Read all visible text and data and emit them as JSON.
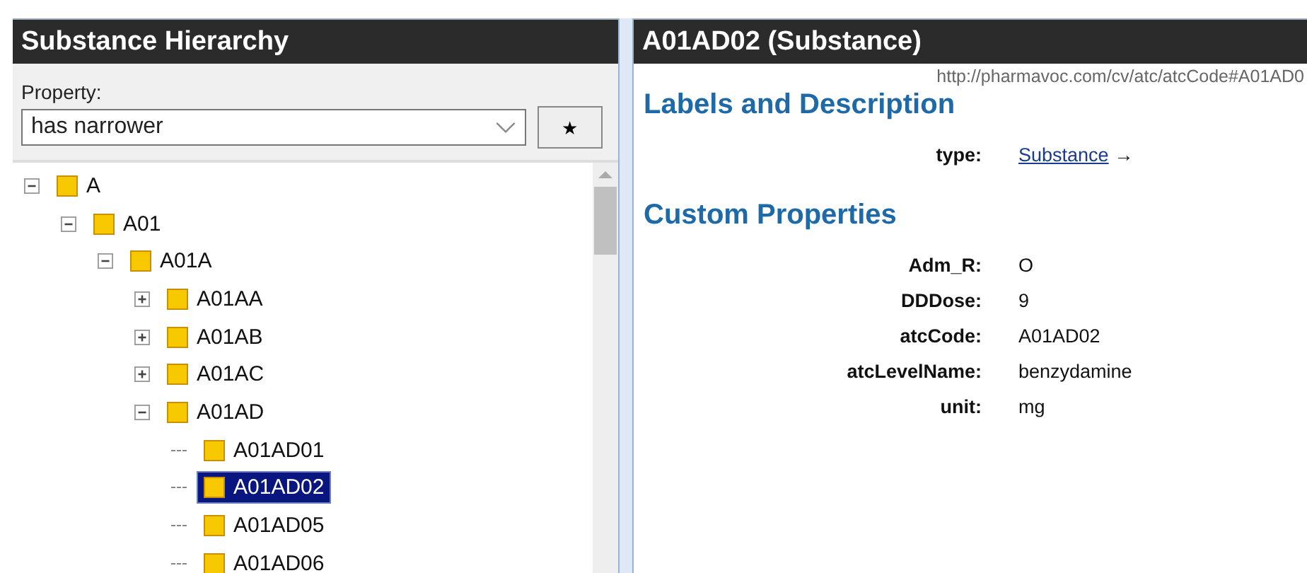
{
  "left_panel": {
    "title": "Substance Hierarchy",
    "property_label": "Property:",
    "property_select": {
      "value": "has narrower"
    },
    "star_button": {
      "label": "★"
    },
    "tree": [
      {
        "label": "A",
        "expanded": true,
        "selected": false,
        "children": [
          {
            "label": "A01",
            "expanded": true,
            "selected": false,
            "children": [
              {
                "label": "A01A",
                "expanded": true,
                "selected": false,
                "children": [
                  {
                    "label": "A01AA",
                    "expanded": false,
                    "selected": false
                  },
                  {
                    "label": "A01AB",
                    "expanded": false,
                    "selected": false
                  },
                  {
                    "label": "A01AC",
                    "expanded": false,
                    "selected": false
                  },
                  {
                    "label": "A01AD",
                    "expanded": true,
                    "selected": false,
                    "children": [
                      {
                        "label": "A01AD01",
                        "selected": false
                      },
                      {
                        "label": "A01AD02",
                        "selected": true
                      },
                      {
                        "label": "A01AD05",
                        "selected": false
                      },
                      {
                        "label": "A01AD06",
                        "selected": false
                      }
                    ]
                  }
                ]
              }
            ]
          }
        ]
      }
    ]
  },
  "right_panel": {
    "title": "A01AD02 (Substance)",
    "uri": "http://pharmavoc.com/cv/atc/atcCode#A01AD0",
    "sections": [
      {
        "heading": "Labels and Description",
        "properties": [
          {
            "name": "type:",
            "value": "Substance",
            "kind": "link",
            "arrow": "→"
          }
        ]
      },
      {
        "heading": "Custom Properties",
        "properties": [
          {
            "name": "Adm_R:",
            "value": "O",
            "kind": "text"
          },
          {
            "name": "DDDose:",
            "value": "9",
            "kind": "text"
          },
          {
            "name": "atcCode:",
            "value": "A01AD02",
            "kind": "text"
          },
          {
            "name": "atcLevelName:",
            "value": "benzydamine",
            "kind": "text"
          },
          {
            "name": "unit:",
            "value": "mg",
            "kind": "text"
          }
        ]
      }
    ]
  }
}
